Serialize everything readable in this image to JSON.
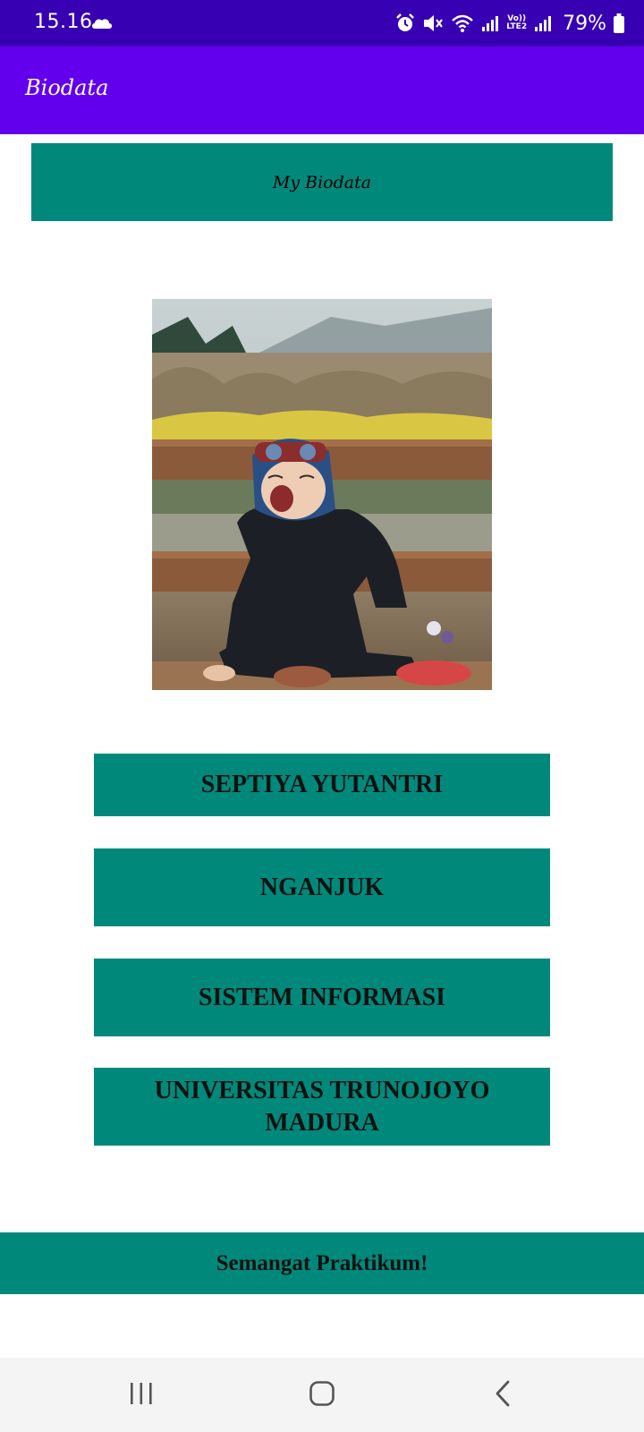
{
  "status_bar": {
    "time": "15.16",
    "battery": "79%",
    "icons": [
      "cloud-icon",
      "alarm-icon",
      "mute-icon",
      "wifi-icon",
      "signal-icon",
      "volte-icon",
      "battery-icon"
    ],
    "volte_label_top": "Vo))",
    "volte_label_bottom": "LTE2"
  },
  "app_bar": {
    "title": "Biodata"
  },
  "header": {
    "label": "My Biodata"
  },
  "photo": {
    "alt": "baby-photo"
  },
  "info": {
    "name": "SEPTIYA YUTANTRI",
    "city": "NGANJUK",
    "major": "SISTEM INFORMASI",
    "university": "UNIVERSITAS TRUNOJOYO MADURA"
  },
  "footer": {
    "label": "Semangat Praktikum!"
  },
  "nav_bar": {
    "icons": [
      "recents-icon",
      "home-icon",
      "back-icon"
    ]
  },
  "colors": {
    "status_bar": "#3700b3",
    "app_bar": "#6200ee",
    "teal": "#00897b",
    "nav_bar": "#f4f4f4"
  }
}
